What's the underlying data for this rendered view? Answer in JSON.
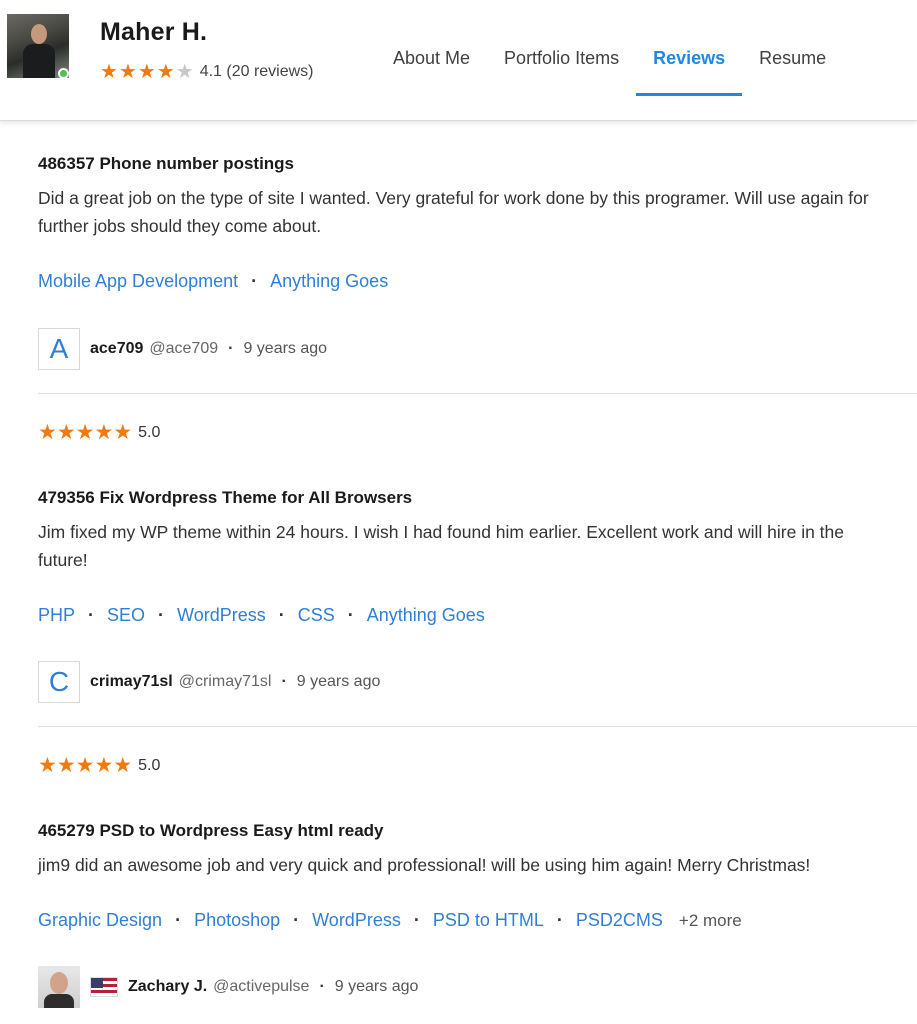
{
  "profile": {
    "name": "Maher H.",
    "rating_stars": 4,
    "rating_text": "4.1 (20 reviews)"
  },
  "tabs": [
    {
      "label": "About Me",
      "active": false
    },
    {
      "label": "Portfolio Items",
      "active": false
    },
    {
      "label": "Reviews",
      "active": true
    },
    {
      "label": "Resume",
      "active": false
    }
  ],
  "reviews": [
    {
      "title": "486357 Phone number postings",
      "body": "Did a great job on the type of site I wanted. Very grateful for work done by this programer. Will use again for further jobs should they come about.",
      "tags": [
        "Mobile App Development",
        "Anything Goes"
      ],
      "reviewer": {
        "avatar_letter": "A",
        "username": "ace709",
        "handle": "@ace709",
        "age": "9 years ago"
      }
    },
    {
      "stars": 5,
      "score": "5.0",
      "title": "479356 Fix Wordpress Theme for All Browsers",
      "body": "Jim fixed my WP theme within 24 hours. I wish I had found him earlier. Excellent work and will hire in the future!",
      "tags": [
        "PHP",
        "SEO",
        "WordPress",
        "CSS",
        "Anything Goes"
      ],
      "reviewer": {
        "avatar_letter": "C",
        "username": "crimay71sl",
        "handle": "@crimay71sl",
        "age": "9 years ago"
      }
    },
    {
      "stars": 5,
      "score": "5.0",
      "title": "465279 PSD to Wordpress Easy html ready",
      "body": "jim9 did an awesome job and very quick and professional! will be using him again! Merry Christmas!",
      "tags": [
        "Graphic Design",
        "Photoshop",
        "WordPress",
        "PSD to HTML",
        "PSD2CMS"
      ],
      "more": "+2 more",
      "reviewer": {
        "username": "Zachary J.",
        "handle": "@activepulse",
        "age": "9 years ago",
        "flag": "us-flag-icon"
      }
    }
  ],
  "colors": {
    "accent": "#1e88e5",
    "link": "#2f7fd4",
    "star": "#f07a0f",
    "online": "#4fc24a"
  }
}
